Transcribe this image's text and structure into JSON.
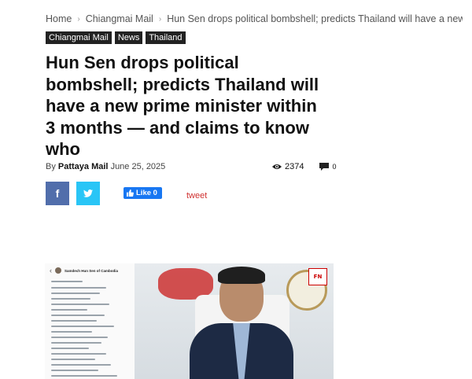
{
  "breadcrumb": {
    "items": [
      "Home",
      "Chiangmai Mail",
      "Hun Sen drops political bombshell; predicts Thailand will have a new prime..."
    ]
  },
  "tags": [
    "Chiangmai Mail",
    "News",
    "Thailand"
  ],
  "article": {
    "title": "Hun Sen drops political bombshell; predicts Thailand will have a new prime minister within 3 months — and claims to know who",
    "by": "By",
    "author": "Pattaya Mail",
    "date": "June 25, 2025",
    "views": "2374",
    "comments": "0"
  },
  "share": {
    "facebook_icon": "f",
    "twitter_icon": "twitter-icon",
    "like_label": "Like 0",
    "tweet_label": "tweet"
  },
  "image": {
    "phone_page_name": "Samdech Hun Sen of Cambodia",
    "badge_text": "FN"
  },
  "colors": {
    "facebook": "#516eab",
    "twitter": "#29c5f6",
    "like": "#1877f2",
    "tweet": "#d0302f"
  }
}
